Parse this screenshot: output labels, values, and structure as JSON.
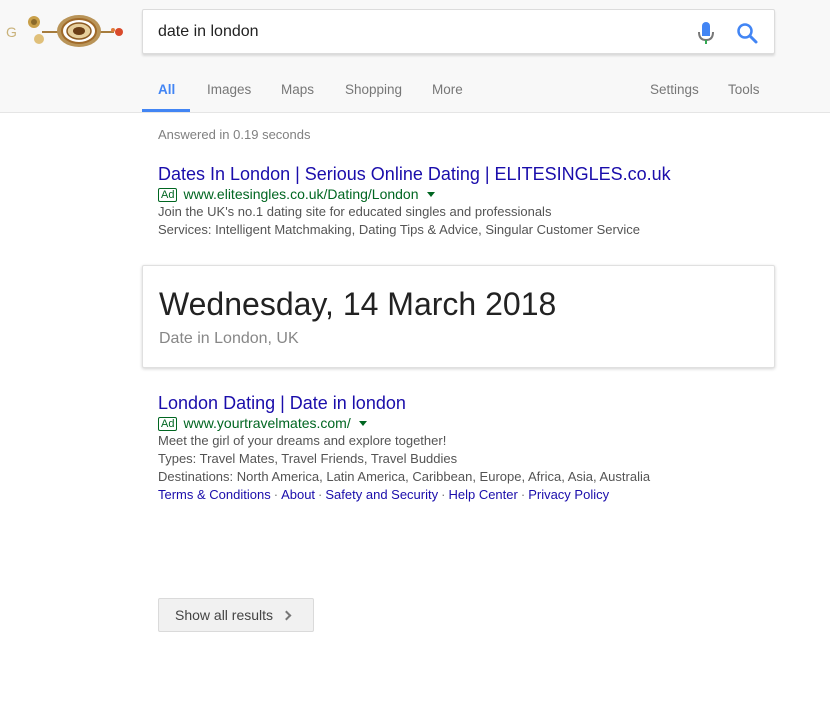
{
  "search": {
    "query": "date in london"
  },
  "tabs": [
    {
      "label": "All"
    },
    {
      "label": "Images"
    },
    {
      "label": "Maps"
    },
    {
      "label": "Shopping"
    },
    {
      "label": "More"
    },
    {
      "label": "Settings"
    },
    {
      "label": "Tools"
    }
  ],
  "stats": "Answered in 0.19 seconds",
  "ad_label": "Ad",
  "results": [
    {
      "title": "Dates In London | Serious Online Dating | ELITESINGLES.co.uk",
      "url": "www.elitesingles.co.uk/Dating/London",
      "lines": [
        "Join the UK's no.1 dating site for educated singles and professionals",
        "Services: Intelligent Matchmaking, Dating Tips & Advice, Singular Customer Service"
      ]
    },
    {
      "title": "London Dating | Date in london",
      "url": "www.yourtravelmates.com/",
      "lines": [
        "Meet the girl of your dreams and explore together!",
        "Types: Travel Mates, Travel Friends, Travel Buddies",
        "Destinations: North America, Latin America, Caribbean, Europe, Africa, Asia, Australia"
      ],
      "sitelinks": [
        "Terms & Conditions",
        "About",
        "Safety and Security",
        "Help Center",
        "Privacy Policy"
      ],
      "separator": "·"
    }
  ],
  "answer": {
    "date": "Wednesday, 14 March 2018",
    "location": "Date in London, UK"
  },
  "show_all": "Show all results",
  "colors": {
    "link": "#1a0dab",
    "url_green": "#006621",
    "accent_blue": "#4285f4",
    "mic_red": "#ea4335"
  },
  "icons": {
    "logo": "doodle-logo",
    "mic": "microphone-icon",
    "search": "search-icon",
    "caret": "caret-down-icon",
    "chevron": "chevron-right-icon"
  }
}
